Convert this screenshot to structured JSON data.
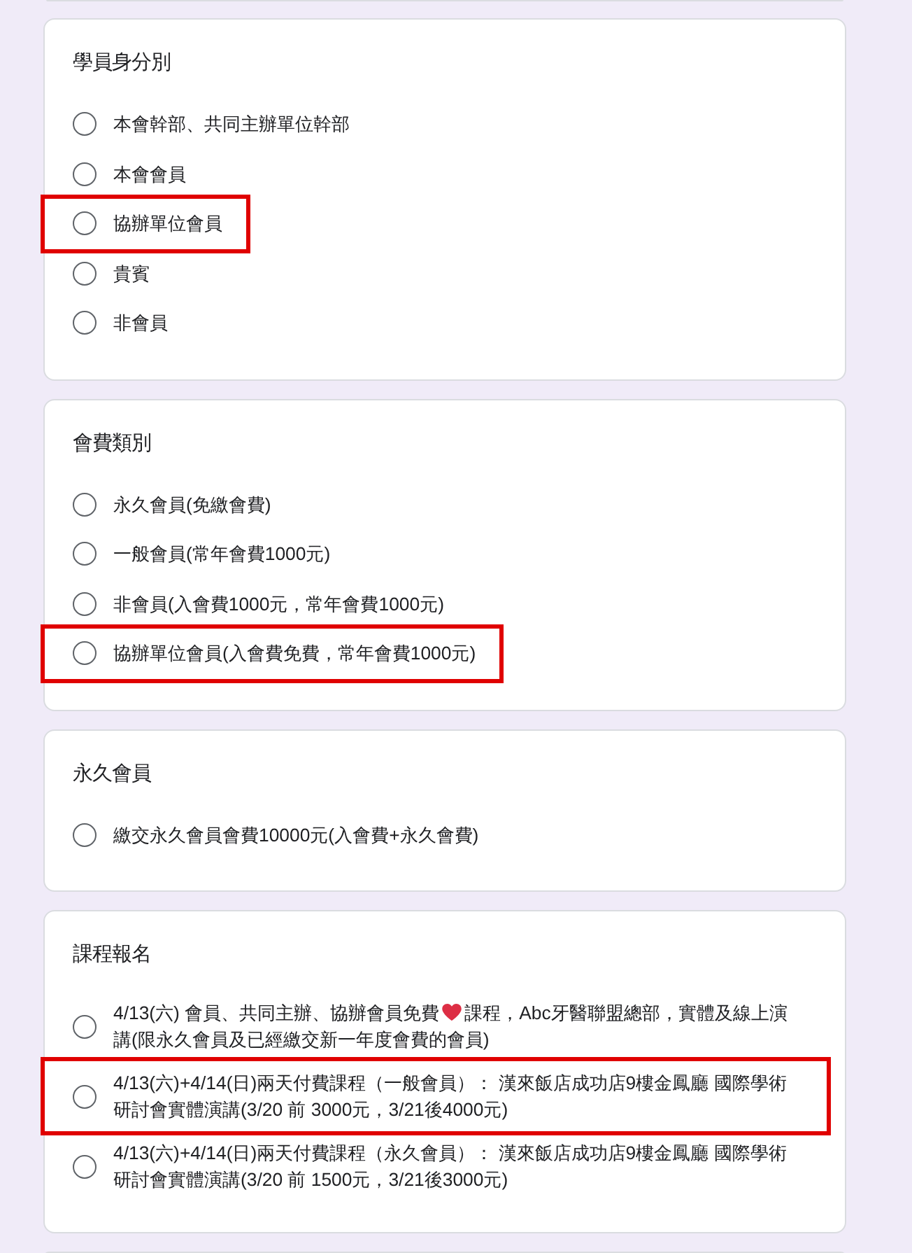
{
  "sections": [
    {
      "title": "學員身分別",
      "options": [
        {
          "kind": "plain",
          "label": "本會幹部、共同主辦單位幹部",
          "selected": false,
          "highlighted": false
        },
        {
          "kind": "plain",
          "label": "本會會員",
          "selected": false,
          "highlighted": false
        },
        {
          "kind": "plain",
          "label": "協辦單位會員",
          "selected": false,
          "highlighted": true
        },
        {
          "kind": "plain",
          "label": "貴賓",
          "selected": false,
          "highlighted": false
        },
        {
          "kind": "plain",
          "label": "非會員",
          "selected": false,
          "highlighted": false
        }
      ]
    },
    {
      "title": "會費類別",
      "options": [
        {
          "kind": "plain",
          "label": "永久會員(免繳會費)",
          "selected": false,
          "highlighted": false
        },
        {
          "kind": "plain",
          "label": "一般會員(常年會費1000元)",
          "selected": false,
          "highlighted": false
        },
        {
          "kind": "plain",
          "label": "非會員(入會費1000元，常年會費1000元)",
          "selected": false,
          "highlighted": false
        },
        {
          "kind": "plain",
          "label": "協辦單位會員(入會費免費，常年會費1000元)",
          "selected": false,
          "highlighted": true
        }
      ]
    },
    {
      "title": "永久會員",
      "options": [
        {
          "kind": "plain",
          "label": "繳交永久會員會費10000元(入會費+永久會費)",
          "selected": false,
          "highlighted": false
        }
      ]
    },
    {
      "title": "課程報名",
      "options": [
        {
          "kind": "inline-icon",
          "label": "4/13(六) 會員、共同主辦、協辦會員免費",
          "label_after_icon": "課程，Abc牙醫聯盟總部，實體及線上演講(限永久會員及已經繳交新一年度會費的會員)",
          "selected": false,
          "highlighted": false
        },
        {
          "kind": "plain",
          "label": "4/13(六)+4/14(日)兩天付費課程（一般會員）： 漢來飯店成功店9樓金鳳廳 國際學術研討會實體演講(3/20 前 3000元，3/21後4000元)",
          "selected": false,
          "highlighted": true
        },
        {
          "kind": "plain",
          "label": "4/13(六)+4/14(日)兩天付費課程（永久會員）： 漢來飯店成功店9樓金鳳廳 國際學術研討會實體演講(3/20 前 1500元，3/21後3000元)",
          "selected": false,
          "highlighted": false
        }
      ]
    }
  ]
}
